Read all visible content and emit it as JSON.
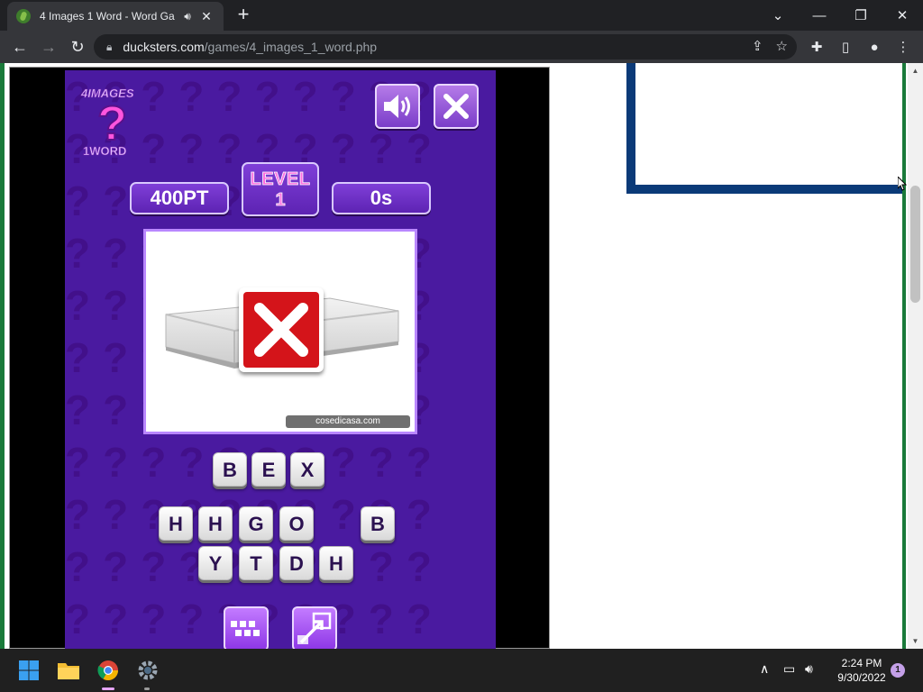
{
  "browser": {
    "tab": {
      "title": "4 Images 1 Word - Word Ga",
      "audio_icon": "speaker-icon",
      "close_icon": "close-icon"
    },
    "new_tab_icon": "plus-icon",
    "window_controls": [
      "chevron-down-icon",
      "minimize-icon",
      "restore-icon",
      "close-icon"
    ],
    "address": {
      "domain": "ducksters.com",
      "path": "/games/4_images_1_word.php"
    },
    "toolbar_icons": [
      "back-icon",
      "forward-icon",
      "reload-icon",
      "lock-icon",
      "share-icon",
      "star-icon",
      "extensions-icon",
      "sidepanel-icon",
      "profile-icon",
      "menu-icon"
    ]
  },
  "game": {
    "logo": {
      "line1": "4IMAGES",
      "mark": "?",
      "line2": "1WORD"
    },
    "score": "400PT",
    "level_label": "LEVEL",
    "level_number": "1",
    "timer": "0s",
    "image_credit": "cosedicasa.com",
    "answer_tiles": [
      "B",
      "E",
      "X"
    ],
    "letter_tiles_row1": [
      "H",
      "H",
      "G",
      "O",
      "B"
    ],
    "letter_tiles_row2": [
      "Y",
      "T",
      "D",
      "H"
    ],
    "controls": [
      "sound-icon",
      "close-game-icon"
    ],
    "tools": [
      "reveal-letters-icon",
      "solve-icon"
    ]
  },
  "taskbar": {
    "apps": [
      "windows-start-icon",
      "file-explorer-icon",
      "chrome-icon",
      "settings-icon"
    ],
    "tray": [
      "chevron-up-icon",
      "network-icon",
      "volume-icon"
    ],
    "time": "2:24 PM",
    "date": "9/30/2022",
    "notification_count": "1"
  },
  "colors": {
    "game_bg": "#4a1aa0",
    "tile_text": "#2b1150",
    "wrong_red": "#d4141a",
    "frame_blue": "#0b3a78",
    "border_green": "#1a7a3a"
  }
}
